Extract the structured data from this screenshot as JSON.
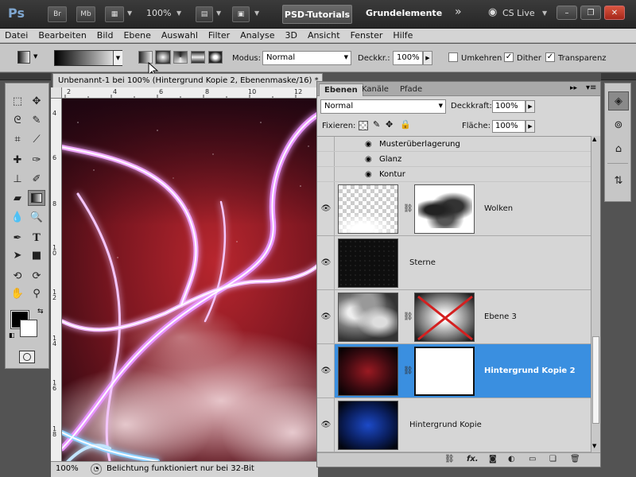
{
  "titlebar": {
    "logo": "Ps",
    "bridge_label": "Br",
    "minibridge_label": "Mb",
    "zoom": "100%",
    "workspace_tab": "PSD-Tutorials",
    "workspace_name": "Grundelemente",
    "more": "»",
    "cs_live": "CS Live"
  },
  "menu": [
    "Datei",
    "Bearbeiten",
    "Bild",
    "Ebene",
    "Auswahl",
    "Filter",
    "Analyse",
    "3D",
    "Ansicht",
    "Fenster",
    "Hilfe"
  ],
  "options": {
    "modus_label": "Modus:",
    "modus_value": "Normal",
    "deckkr_label": "Deckkr.:",
    "deckkr_value": "100%",
    "umkehren_label": "Umkehren",
    "dither_label": "Dither",
    "transparenz_label": "Transparenz"
  },
  "document": {
    "tab_title": "Unbenannt-1 bei 100% (Hintergrund Kopie 2, Ebenenmaske/16) *",
    "ruler_h": [
      "2",
      "4",
      "6",
      "8",
      "10",
      "12"
    ],
    "ruler_v": [
      "4",
      "6",
      "8",
      "1 0",
      "1 2",
      "1 4",
      "1 6",
      "1 8"
    ],
    "zoom": "100%",
    "status": "Belichtung funktioniert nur bei 32-Bit"
  },
  "layers_panel": {
    "tabs": [
      "Ebenen",
      "Kanäle",
      "Pfade"
    ],
    "blend_mode": "Normal",
    "opacity_label": "Deckkraft:",
    "opacity_value": "100%",
    "lock_label": "Fixieren:",
    "fill_label": "Fläche:",
    "fill_value": "100%",
    "effects": [
      "Musterüberlagerung",
      "Glanz",
      "Kontur"
    ],
    "layers": [
      {
        "name": "Wolken"
      },
      {
        "name": "Sterne"
      },
      {
        "name": "Ebene 3"
      },
      {
        "name": "Hintergrund Kopie 2"
      },
      {
        "name": "Hintergrund Kopie"
      }
    ]
  },
  "colors": {
    "selection": "#3a8fe0",
    "foreground": "#000000",
    "background": "#ffffff"
  }
}
